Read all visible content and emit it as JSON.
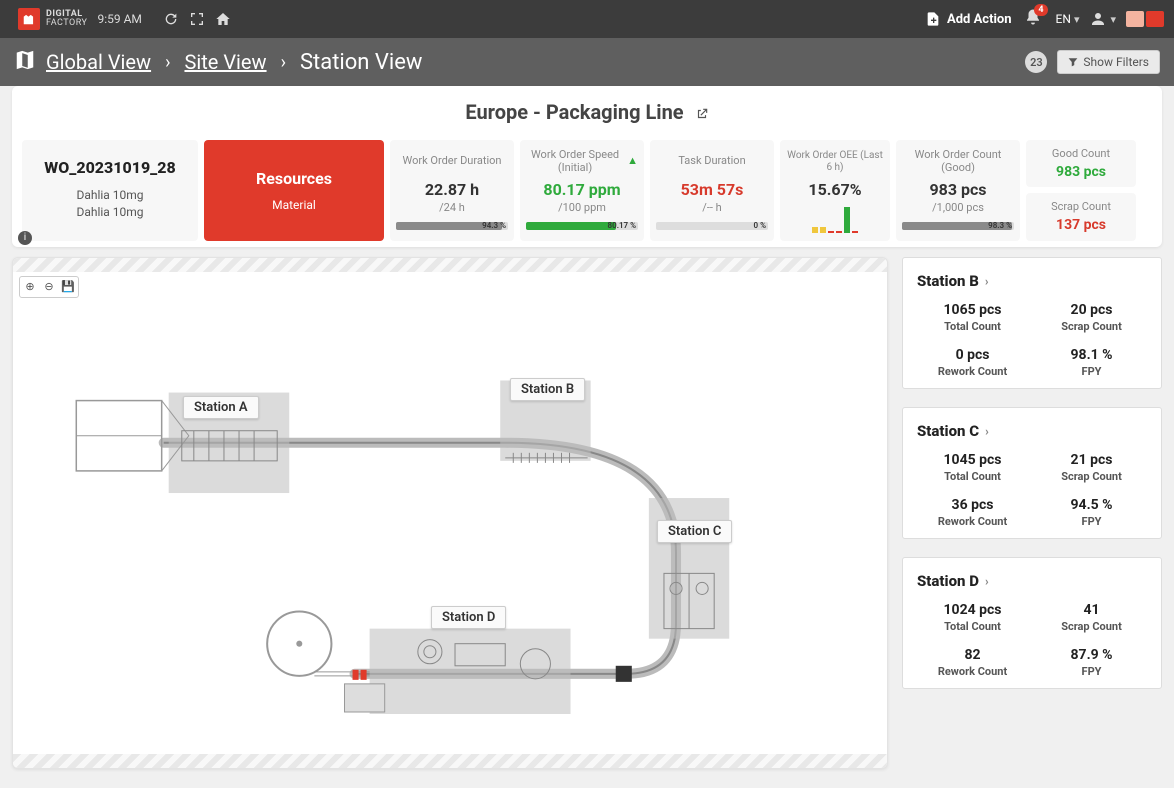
{
  "topbar": {
    "brand_line1": "DIGITAL",
    "brand_line2": "FACTORY",
    "clock": "9:59 AM",
    "add_action_label": "Add Action",
    "notif_count": "4",
    "lang": "EN"
  },
  "breadcrumb": {
    "global": "Global View",
    "site": "Site View",
    "station": "Station View",
    "badge_count": "23",
    "filters_label": "Show Filters"
  },
  "page_title": "Europe - Packaging Line",
  "wo": {
    "id": "WO_20231019_28",
    "line1": "Dahlia 10mg",
    "line2": "Dahlia 10mg"
  },
  "resources": {
    "title": "Resources",
    "sub": "Material"
  },
  "kpi": {
    "duration": {
      "label": "Work Order Duration",
      "value": "22.87 h",
      "sub": "/24 h",
      "pct_text": "94.3 %",
      "pct_width": "94.3%",
      "color": "#8a8a8a"
    },
    "speed": {
      "label": "Work Order Speed (Initial)",
      "value": "80.17 ppm",
      "sub": "/100 ppm",
      "pct_text": "80.17 %",
      "pct_width": "80.17%",
      "color": "#2faa3c"
    },
    "task": {
      "label": "Task Duration",
      "value": "53m 57s",
      "sub": "/-- h",
      "pct_text": "0 %",
      "pct_width": "0%"
    },
    "oee": {
      "label": "Work Order OEE (Last 6 h)",
      "value": "15.67%",
      "bars": [
        "#f0c73d",
        "#f0c73d",
        "#e03a2b",
        "#e03a2b",
        "#2faa3c",
        "#e03a2b"
      ],
      "heights": [
        6,
        6,
        2,
        2,
        26,
        2
      ]
    },
    "good": {
      "label": "Work Order Count (Good)",
      "value": "983 pcs",
      "sub": "/1,000 pcs",
      "pct_text": "98.3 %",
      "pct_width": "98.3%",
      "color": "#8a8a8a"
    },
    "good_mini": {
      "label": "Good Count",
      "value": "983 pcs"
    },
    "scrap_mini": {
      "label": "Scrap Count",
      "value": "137 pcs"
    }
  },
  "diagram_stations": {
    "a": "Station A",
    "b": "Station B",
    "c": "Station C",
    "d": "Station D"
  },
  "station_cards": [
    {
      "name": "Station B",
      "total": "1065 pcs",
      "scrap": "20 pcs",
      "rework": "0 pcs",
      "fpy": "98.1 %"
    },
    {
      "name": "Station C",
      "total": "1045 pcs",
      "scrap": "21 pcs",
      "rework": "36 pcs",
      "fpy": "94.5 %"
    },
    {
      "name": "Station D",
      "total": "1024 pcs",
      "scrap": "41",
      "rework": "82",
      "fpy": "87.9 %"
    }
  ],
  "labels": {
    "total_count": "Total Count",
    "scrap_count": "Scrap Count",
    "rework_count": "Rework Count",
    "fpy": "FPY"
  }
}
